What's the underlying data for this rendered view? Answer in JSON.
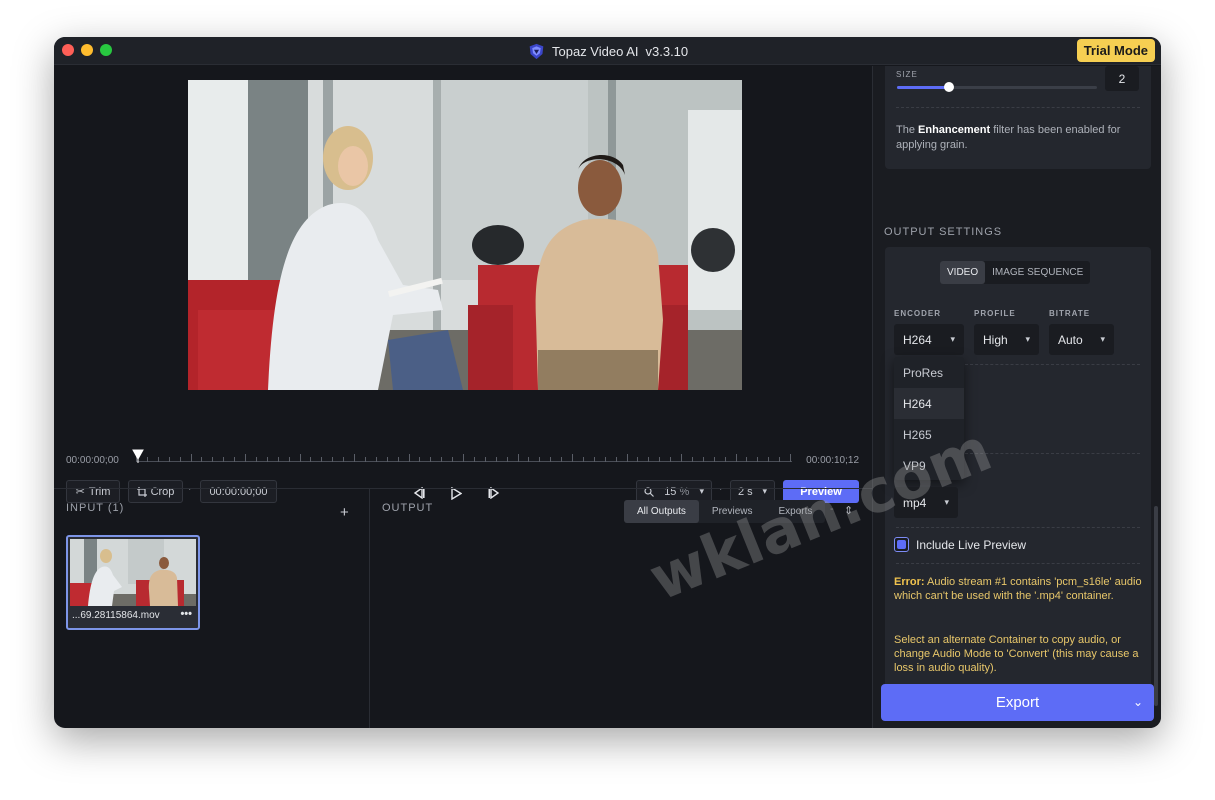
{
  "window": {
    "title": "Topaz Video AI",
    "version": "v3.3.10",
    "trial_badge": "Trial Mode"
  },
  "timeline": {
    "start_time": "00:00:00;00",
    "end_time": "00:00:10;12",
    "trim_label": "Trim",
    "crop_label": "Crop",
    "current_time": "00:00:00;00",
    "zoom_value": "15",
    "zoom_unit": "%",
    "duration_value": "2 s",
    "preview_label": "Preview"
  },
  "input_panel": {
    "title": "INPUT (1)",
    "add_label": "+",
    "file_name": "...69.28115864.mov",
    "more_label": "•••"
  },
  "output_panel": {
    "title": "OUTPUT",
    "tabs": [
      {
        "label": "All Outputs",
        "active": true
      },
      {
        "label": "Previews",
        "active": false
      },
      {
        "label": "Exports",
        "active": false
      }
    ],
    "separator": "-"
  },
  "grain": {
    "size_label": "SIZE",
    "size_value": "2",
    "size_fraction": 0.26,
    "note_prefix": "The ",
    "note_bold": "Enhancement",
    "note_suffix": " filter has been enabled for applying grain."
  },
  "output_settings": {
    "title": "OUTPUT SETTINGS",
    "mode_tabs": [
      {
        "label": "VIDEO",
        "active": true
      },
      {
        "label": "IMAGE SEQUENCE",
        "active": false
      }
    ],
    "encoder_label": "ENCODER",
    "encoder_value": "H264",
    "profile_label": "PROFILE",
    "profile_value": "High",
    "bitrate_label": "BITRATE",
    "bitrate_value": "Auto",
    "encoder_options": [
      "ProRes",
      "H264",
      "H265",
      "VP9"
    ],
    "container_value": "mp4",
    "live_preview_label": "Include Live Preview",
    "live_preview_checked": true,
    "error_prefix": "Error:",
    "error_message": " Audio stream #1 contains 'pcm_s16le' audio which can't be used with the '.mp4' container.",
    "hint_message": "Select an alternate Container to copy audio, or change Audio Mode to 'Convert' (this may cause a loss in audio quality)."
  },
  "export": {
    "label": "Export"
  },
  "watermark": "wklan.com",
  "colors": {
    "accent": "#5d6cf6",
    "trial": "#f6cf52",
    "error": "#e8c76a"
  }
}
